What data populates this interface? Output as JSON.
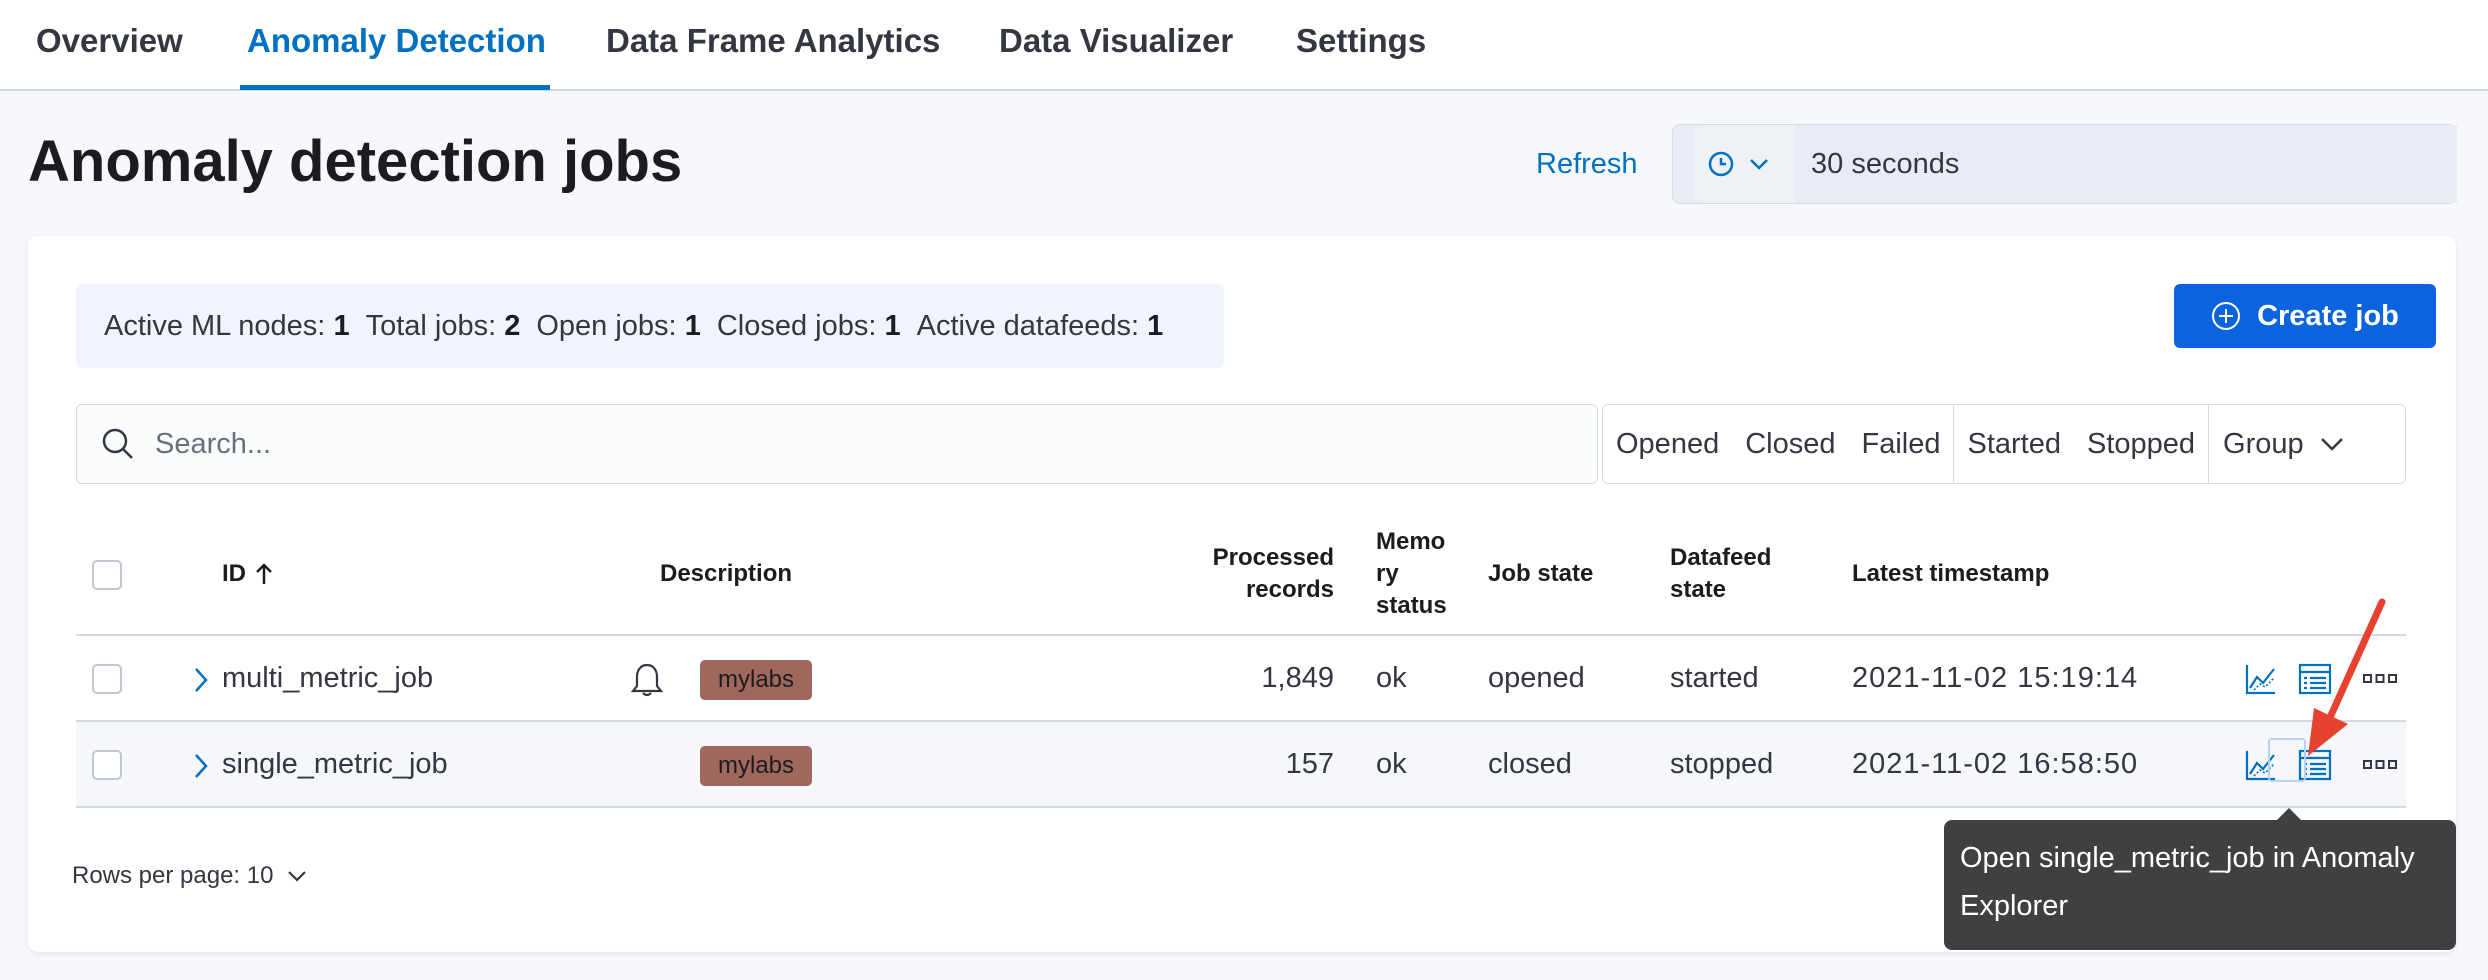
{
  "tabs": [
    {
      "label": "Overview",
      "active": false
    },
    {
      "label": "Anomaly Detection",
      "active": true
    },
    {
      "label": "Data Frame Analytics",
      "active": false
    },
    {
      "label": "Data Visualizer",
      "active": false
    },
    {
      "label": "Settings",
      "active": false
    }
  ],
  "header": {
    "title": "Anomaly detection jobs",
    "refresh_label": "Refresh",
    "interval_value": "30 seconds"
  },
  "stats": [
    {
      "label": "Active ML nodes:",
      "value": "1"
    },
    {
      "label": "Total jobs:",
      "value": "2"
    },
    {
      "label": "Open jobs:",
      "value": "1"
    },
    {
      "label": "Closed jobs:",
      "value": "1"
    },
    {
      "label": "Active datafeeds:",
      "value": "1"
    }
  ],
  "create_job_label": "Create job",
  "search": {
    "placeholder": "Search...",
    "value": ""
  },
  "filters": {
    "state": [
      "Opened",
      "Closed",
      "Failed"
    ],
    "datafeed": [
      "Started",
      "Stopped"
    ],
    "group_label": "Group"
  },
  "table": {
    "columns": {
      "id": "ID",
      "description": "Description",
      "processed_records_1": "Processed",
      "processed_records_2": "records",
      "memory_status_1": "Memo",
      "memory_status_2": "ry",
      "memory_status_3": "status",
      "job_state": "Job state",
      "datafeed_state_1": "Datafeed",
      "datafeed_state_2": "state",
      "latest_timestamp": "Latest timestamp"
    },
    "rows": [
      {
        "id": "multi_metric_job",
        "has_alert": true,
        "group": "mylabs",
        "processed_records": "1,849",
        "memory_status": "ok",
        "job_state": "opened",
        "datafeed_state": "started",
        "latest_timestamp": "2021-11-02 15:19:14"
      },
      {
        "id": "single_metric_job",
        "has_alert": false,
        "group": "mylabs",
        "processed_records": "157",
        "memory_status": "ok",
        "job_state": "closed",
        "datafeed_state": "stopped",
        "latest_timestamp": "2021-11-02 16:58:50"
      }
    ]
  },
  "pagination": {
    "rows_per_page_label": "Rows per page: 10"
  },
  "tooltip": {
    "text": "Open single_metric_job in Anomaly Explorer"
  },
  "colors": {
    "accent": "#0071c2",
    "primary_button": "#0b64dd",
    "group_badge": "#a0675c",
    "annotation_arrow": "#e7412f"
  }
}
